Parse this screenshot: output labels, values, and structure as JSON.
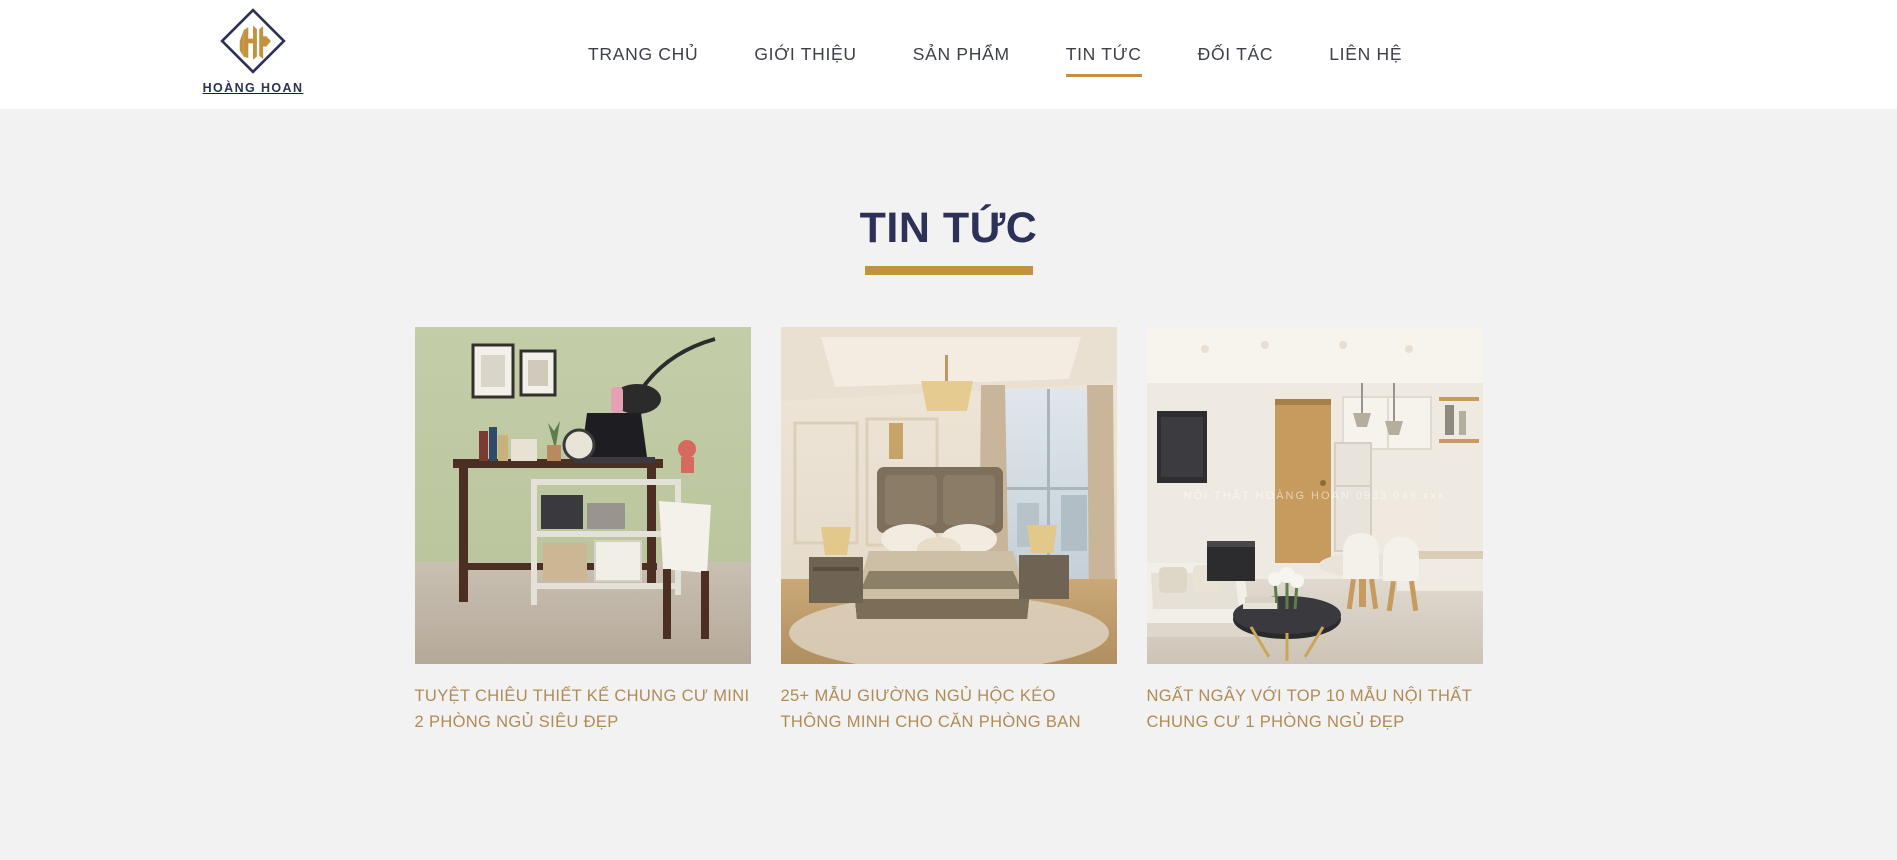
{
  "brand": {
    "name": "HOÀNG HOAN",
    "logo_icon": "diamond-hh-monogram-icon",
    "diamond_color": "#2d3158",
    "monogram_color": "#c2923f"
  },
  "nav": {
    "items": [
      {
        "label": "TRANG CHỦ",
        "active": false
      },
      {
        "label": "GIỚI THIỆU",
        "active": false
      },
      {
        "label": "SẢN PHẨM",
        "active": false
      },
      {
        "label": "TIN TỨC",
        "active": true
      },
      {
        "label": "ĐỐI TÁC",
        "active": false
      },
      {
        "label": "LIÊN HỆ",
        "active": false
      }
    ],
    "active_color": "#c2923f",
    "text_color": "#3e4049"
  },
  "section": {
    "title": "TIN TỨC",
    "title_color": "#2d3158",
    "rule_color": "#c2923f",
    "background": "#f2f2f2"
  },
  "cards": [
    {
      "title": "TUYỆT CHIÊU THIẾT KẾ CHUNG CƯ MINI 2 PHÒNG NGỦ SIÊU ĐẸP",
      "image_alt": "home-office-desk-green-wall-photo",
      "watermark": ""
    },
    {
      "title": "25+ MẪU GIƯỜNG NGỦ HỘC KÉO THÔNG MINH CHO CĂN PHÒNG BAN",
      "image_alt": "bedroom-with-upholstered-bed-photo",
      "watermark": ""
    },
    {
      "title": "NGẤT NGÂY VỚI TOP 10 MẪU NỘI THẤT CHUNG CƯ 1 PHÒNG NGỦ ĐẸP",
      "image_alt": "open-plan-living-kitchen-photo",
      "watermark": "NỘI THẤT HOÀNG HOAN  0933.049.xxx"
    }
  ],
  "title_color": "#b08b55"
}
